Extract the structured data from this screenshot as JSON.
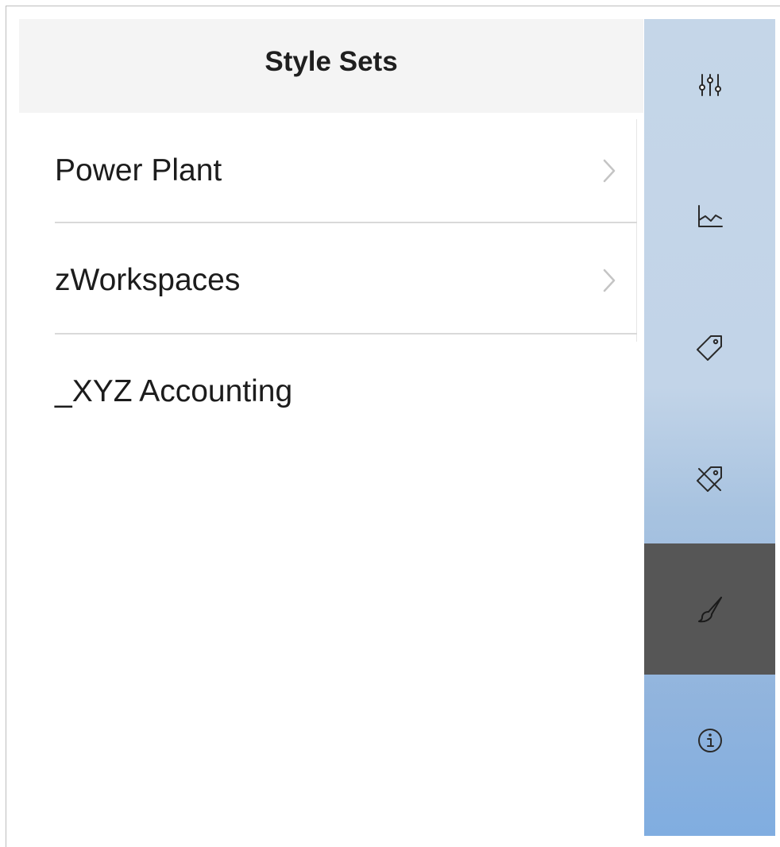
{
  "header": {
    "title": "Style Sets"
  },
  "style_sets": [
    {
      "label": "Power Plant",
      "has_chevron": true
    },
    {
      "label": "zWorkspaces",
      "has_chevron": true
    },
    {
      "label": "_XYZ Accounting",
      "has_chevron": false
    }
  ],
  "rail": {
    "buttons": [
      {
        "icon": "sliders-icon",
        "active": false
      },
      {
        "icon": "line-chart-icon",
        "active": false
      },
      {
        "icon": "tag-icon",
        "active": false
      },
      {
        "icon": "tag-off-icon",
        "active": false
      },
      {
        "icon": "paintbrush-icon",
        "active": true
      },
      {
        "icon": "info-icon",
        "active": false
      }
    ]
  },
  "colors": {
    "header_bg": "#f4f4f4",
    "rail_top": "#c5d6e8",
    "rail_bottom": "#80ade0",
    "active_bg": "#565656"
  }
}
